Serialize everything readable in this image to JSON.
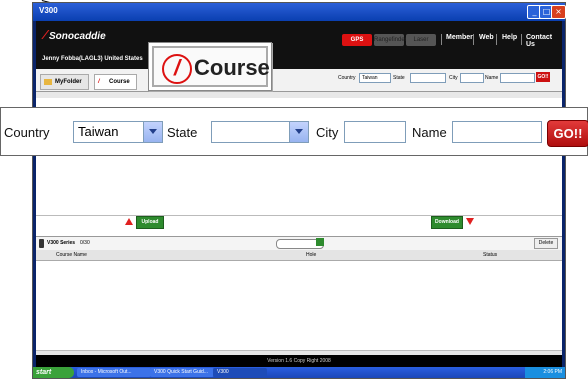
{
  "window": {
    "title": "V300"
  },
  "header": {
    "brand": "Sonocaddie",
    "user": "Jenny Fobba(LAGL3) United States",
    "modes": [
      "GPS",
      "Rangefinder",
      "Laser"
    ],
    "nav": [
      "Member",
      "Web",
      "Help",
      "Contact Us"
    ]
  },
  "tabs": [
    "MyFolder",
    "Course"
  ],
  "filters": {
    "country_label": "Country",
    "country_value": "Taiwan",
    "state_label": "State",
    "state_value": "",
    "city_label": "City",
    "city_value": "",
    "name_label": "Name",
    "name_value": "",
    "go_label": "GO!!"
  },
  "transfer": {
    "upload": "Upload",
    "download": "Download"
  },
  "device": {
    "name": "V300 Series",
    "count": "0/30",
    "delete": "Delete"
  },
  "table": {
    "columns": [
      "Course Name",
      "Hole",
      "Status"
    ]
  },
  "status_line": "Version 1.6 Copy Right 2008",
  "taskbar": {
    "start": "start",
    "items": [
      "Inbox - Microsoft Out...",
      "V300 Quick Start Guid...",
      "V300"
    ],
    "clock": "2:06 PM"
  },
  "callouts": {
    "course_label": "Course"
  },
  "colors": {
    "accent_red": "#d11111",
    "green": "#2e8b2e",
    "header": "#111111"
  }
}
